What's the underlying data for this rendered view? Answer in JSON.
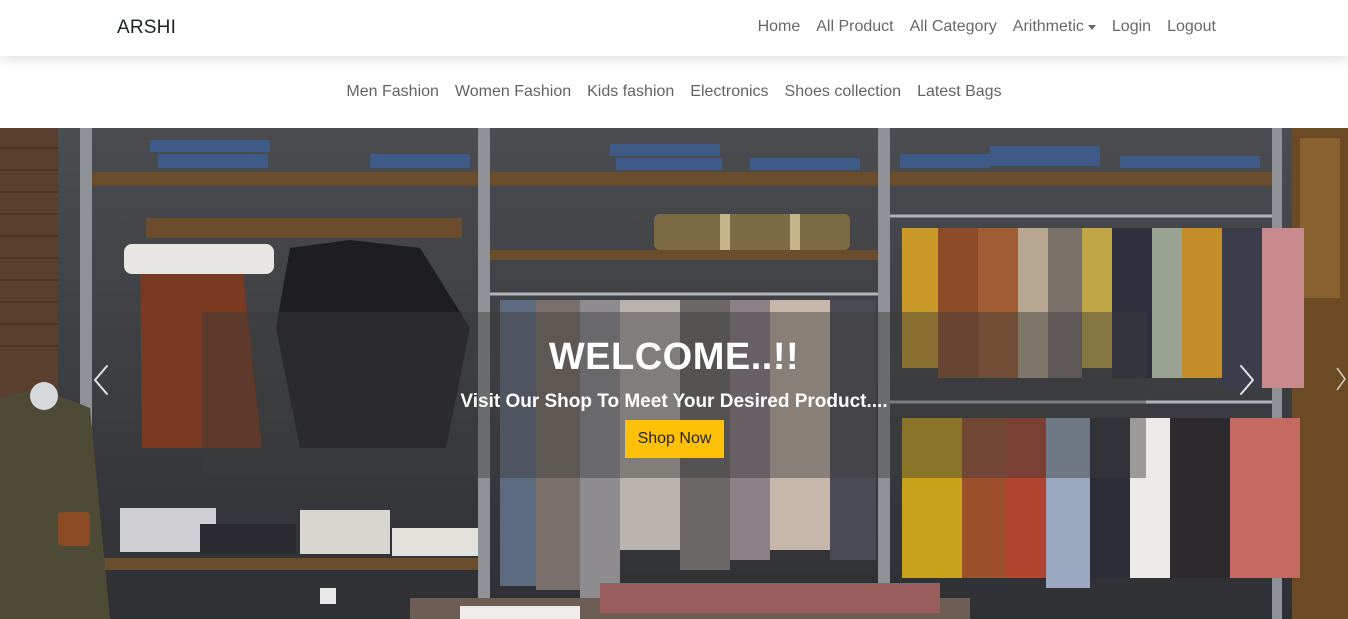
{
  "navbar": {
    "brand": "ARSHI",
    "links": {
      "home": "Home",
      "all_product": "All Product",
      "all_category": "All Category",
      "arithmetic": "Arithmetic",
      "login": "Login",
      "logout": "Logout"
    }
  },
  "categories": {
    "men": "Men Fashion",
    "women": "Women Fashion",
    "kids": "Kids fashion",
    "electronics": "Electronics",
    "shoes": "Shoes collection",
    "bags": "Latest Bags"
  },
  "hero": {
    "title": "WELCOME..!!",
    "subtitle": "Visit Our Shop To Meet Your Desired Product....",
    "button": "Shop Now",
    "prev_icon": "chevron-left-icon",
    "next_icon": "chevron-right-icon"
  },
  "colors": {
    "button": "#ffc107",
    "nav_text": "#6c757d"
  }
}
